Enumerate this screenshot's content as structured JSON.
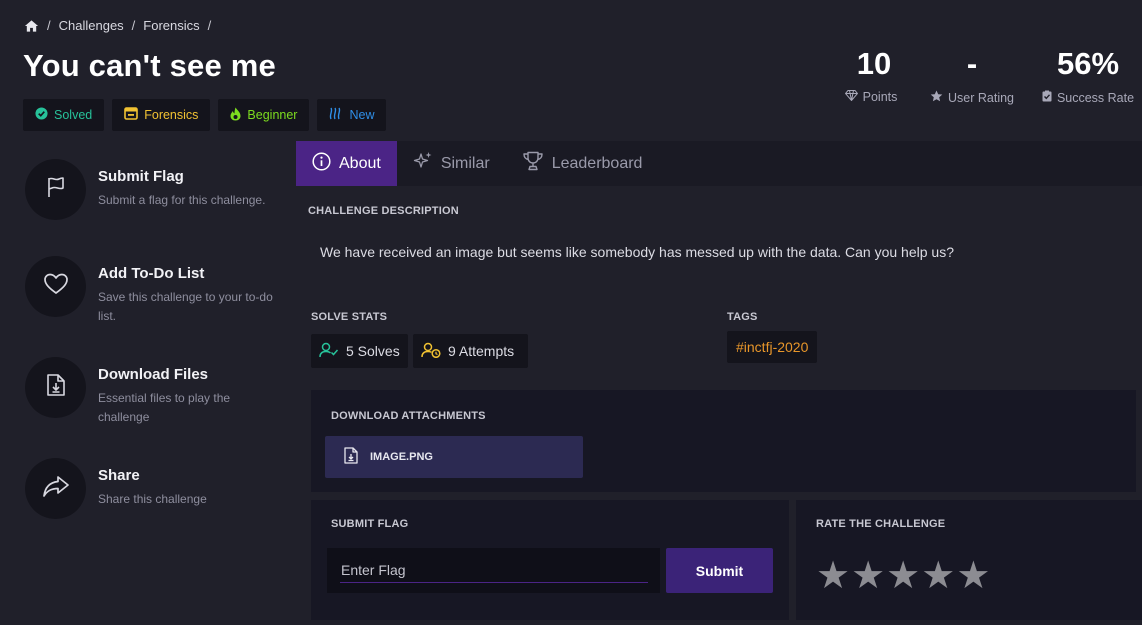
{
  "breadcrumb": {
    "items": [
      "Challenges",
      "Forensics"
    ]
  },
  "title": "You can't see me",
  "badges": [
    {
      "label": "Solved",
      "color": "#27c29a",
      "icon": "check-circle-icon"
    },
    {
      "label": "Forensics",
      "color": "#f1c232",
      "icon": "box-icon"
    },
    {
      "label": "Beginner",
      "color": "#7ddc1f",
      "icon": "flame-icon"
    },
    {
      "label": "New",
      "color": "#2f8fe8",
      "icon": "waves-icon"
    }
  ],
  "stats": {
    "points": {
      "value": "10",
      "label": "Points"
    },
    "user_rating": {
      "value": "-",
      "label": "User Rating"
    },
    "success_rate": {
      "value": "56%",
      "label": "Success Rate"
    }
  },
  "sidebar": {
    "submit_flag": {
      "title": "Submit Flag",
      "desc": "Submit a flag for this challenge."
    },
    "todo": {
      "title": "Add To-Do List",
      "desc": "Save this challenge to your to-do list."
    },
    "download": {
      "title": "Download Files",
      "desc": "Essential files to play the challenge"
    },
    "share": {
      "title": "Share",
      "desc": "Share this challenge"
    }
  },
  "tabs": {
    "about": "About",
    "similar": "Similar",
    "leaderboard": "Leaderboard"
  },
  "description": {
    "heading": "CHALLENGE DESCRIPTION",
    "text": "We have received an image but seems like somebody has messed up with the data. Can you help us?"
  },
  "solve_stats": {
    "heading": "SOLVE STATS",
    "solves": "5 Solves",
    "attempts": "9 Attempts"
  },
  "tags": {
    "heading": "TAGS",
    "items": [
      "#inctfj-2020"
    ]
  },
  "attachments": {
    "heading": "DOWNLOAD ATTACHMENTS",
    "file": "IMAGE.PNG"
  },
  "submit": {
    "heading": "SUBMIT FLAG",
    "placeholder": "Enter Flag",
    "button": "Submit"
  },
  "rate": {
    "heading": "RATE THE CHALLENGE",
    "stars": 5
  },
  "colors": {
    "accent": "#4b2486",
    "submit_button": "#3b2378",
    "tag": "#e8962a"
  }
}
